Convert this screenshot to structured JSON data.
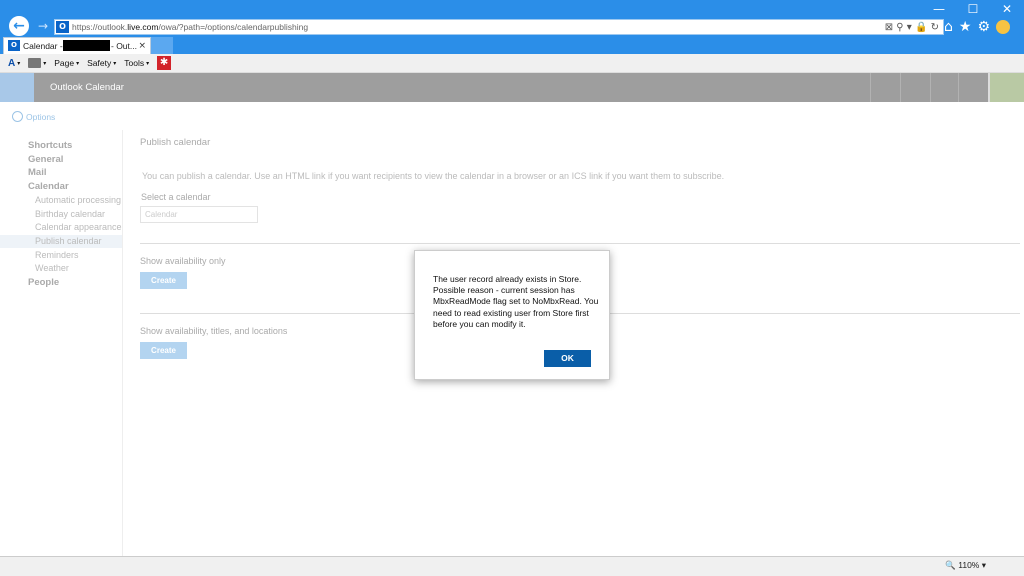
{
  "browser": {
    "url_prefix": "https://outlook.",
    "url_domain": "live.com",
    "url_rest": "/owa/?path=/options/calendarpublishing",
    "tab_label_start": "Calendar - ",
    "tab_label_end": "- Out...",
    "tab_close": "×",
    "win_min": "—",
    "win_max": "☐",
    "win_close": "✕",
    "back_glyph": "←",
    "fwd_glyph": "→",
    "icons": [
      "home-icon",
      "favorites-star-icon",
      "settings-gear-icon",
      "smiley-feedback-icon"
    ],
    "home_glyph": "⌂",
    "star_glyph": "★",
    "gear_glyph": "⚙",
    "addr_tools": "⊠ ⚲ ▾ 🔒 ↻"
  },
  "commandbar": {
    "page": "Page",
    "safety": "Safety",
    "tools": "Tools",
    "arrow": "▾",
    "red_icon": "✱"
  },
  "owa": {
    "title": "Outlook Calendar",
    "options_link": "Options"
  },
  "leftnav": {
    "shortcuts": "Shortcuts",
    "general": "General",
    "mail": "Mail",
    "calendar": "Calendar",
    "calendar_items": [
      "Automatic processing",
      "Birthday calendar",
      "Calendar appearance",
      "Publish calendar",
      "Reminders",
      "Weather"
    ],
    "people": "People"
  },
  "main": {
    "title": "Publish calendar",
    "description": "You can publish a calendar. Use an HTML link if you want recipients to view the calendar in a browser or an ICS link if you want them to subscribe.",
    "select_label": "Select a calendar",
    "select_value": "Calendar",
    "section1_label": "Show availability only",
    "section2_label": "Show availability, titles, and locations",
    "create_label": "Create"
  },
  "dialog": {
    "message": "The user record already exists in Store. Possible reason - current session has MbxReadMode flag set to NoMbxRead. You need to read existing user from Store first before you can modify it.",
    "ok": "OK"
  },
  "statusbar": {
    "zoom": "🔍 110% ▾"
  }
}
